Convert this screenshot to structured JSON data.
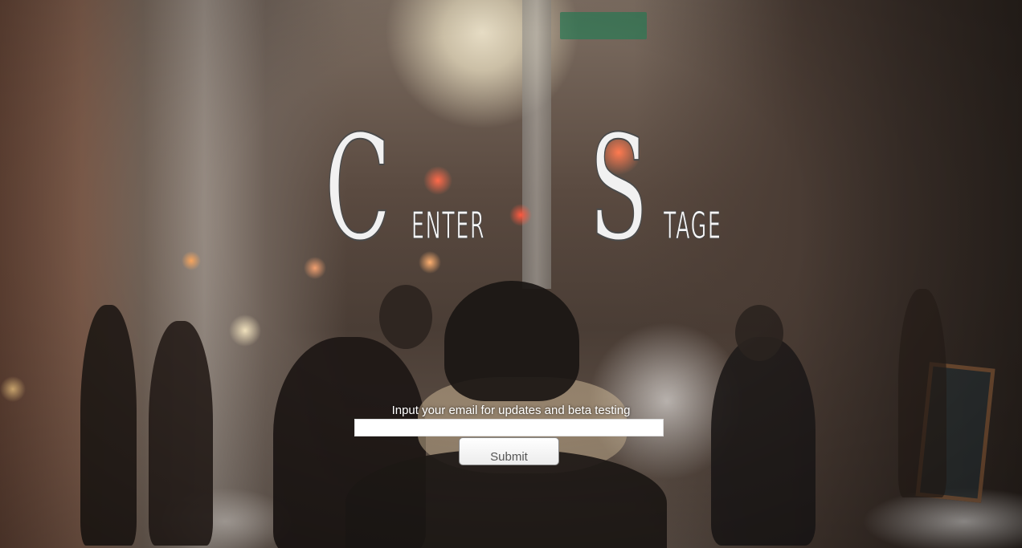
{
  "logo": {
    "word1_cap": "C",
    "word1_rest": "ENTER",
    "word2_cap": "S",
    "word2_rest": "TAGE"
  },
  "signup": {
    "prompt": "Input your email for updates and beta testing",
    "email_value": "",
    "email_placeholder": "",
    "submit_label": "Submit"
  }
}
